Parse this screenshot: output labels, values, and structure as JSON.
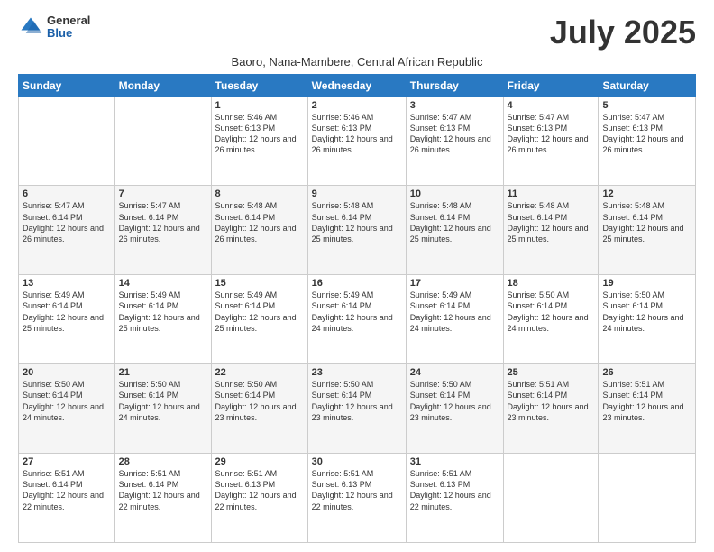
{
  "logo": {
    "general": "General",
    "blue": "Blue"
  },
  "title": {
    "month": "July 2025",
    "location": "Baoro, Nana-Mambere, Central African Republic"
  },
  "weekdays": [
    "Sunday",
    "Monday",
    "Tuesday",
    "Wednesday",
    "Thursday",
    "Friday",
    "Saturday"
  ],
  "weeks": [
    [
      {
        "day": "",
        "info": ""
      },
      {
        "day": "",
        "info": ""
      },
      {
        "day": "1",
        "info": "Sunrise: 5:46 AM\nSunset: 6:13 PM\nDaylight: 12 hours and 26 minutes."
      },
      {
        "day": "2",
        "info": "Sunrise: 5:46 AM\nSunset: 6:13 PM\nDaylight: 12 hours and 26 minutes."
      },
      {
        "day": "3",
        "info": "Sunrise: 5:47 AM\nSunset: 6:13 PM\nDaylight: 12 hours and 26 minutes."
      },
      {
        "day": "4",
        "info": "Sunrise: 5:47 AM\nSunset: 6:13 PM\nDaylight: 12 hours and 26 minutes."
      },
      {
        "day": "5",
        "info": "Sunrise: 5:47 AM\nSunset: 6:13 PM\nDaylight: 12 hours and 26 minutes."
      }
    ],
    [
      {
        "day": "6",
        "info": "Sunrise: 5:47 AM\nSunset: 6:14 PM\nDaylight: 12 hours and 26 minutes."
      },
      {
        "day": "7",
        "info": "Sunrise: 5:47 AM\nSunset: 6:14 PM\nDaylight: 12 hours and 26 minutes."
      },
      {
        "day": "8",
        "info": "Sunrise: 5:48 AM\nSunset: 6:14 PM\nDaylight: 12 hours and 26 minutes."
      },
      {
        "day": "9",
        "info": "Sunrise: 5:48 AM\nSunset: 6:14 PM\nDaylight: 12 hours and 25 minutes."
      },
      {
        "day": "10",
        "info": "Sunrise: 5:48 AM\nSunset: 6:14 PM\nDaylight: 12 hours and 25 minutes."
      },
      {
        "day": "11",
        "info": "Sunrise: 5:48 AM\nSunset: 6:14 PM\nDaylight: 12 hours and 25 minutes."
      },
      {
        "day": "12",
        "info": "Sunrise: 5:48 AM\nSunset: 6:14 PM\nDaylight: 12 hours and 25 minutes."
      }
    ],
    [
      {
        "day": "13",
        "info": "Sunrise: 5:49 AM\nSunset: 6:14 PM\nDaylight: 12 hours and 25 minutes."
      },
      {
        "day": "14",
        "info": "Sunrise: 5:49 AM\nSunset: 6:14 PM\nDaylight: 12 hours and 25 minutes."
      },
      {
        "day": "15",
        "info": "Sunrise: 5:49 AM\nSunset: 6:14 PM\nDaylight: 12 hours and 25 minutes."
      },
      {
        "day": "16",
        "info": "Sunrise: 5:49 AM\nSunset: 6:14 PM\nDaylight: 12 hours and 24 minutes."
      },
      {
        "day": "17",
        "info": "Sunrise: 5:49 AM\nSunset: 6:14 PM\nDaylight: 12 hours and 24 minutes."
      },
      {
        "day": "18",
        "info": "Sunrise: 5:50 AM\nSunset: 6:14 PM\nDaylight: 12 hours and 24 minutes."
      },
      {
        "day": "19",
        "info": "Sunrise: 5:50 AM\nSunset: 6:14 PM\nDaylight: 12 hours and 24 minutes."
      }
    ],
    [
      {
        "day": "20",
        "info": "Sunrise: 5:50 AM\nSunset: 6:14 PM\nDaylight: 12 hours and 24 minutes."
      },
      {
        "day": "21",
        "info": "Sunrise: 5:50 AM\nSunset: 6:14 PM\nDaylight: 12 hours and 24 minutes."
      },
      {
        "day": "22",
        "info": "Sunrise: 5:50 AM\nSunset: 6:14 PM\nDaylight: 12 hours and 23 minutes."
      },
      {
        "day": "23",
        "info": "Sunrise: 5:50 AM\nSunset: 6:14 PM\nDaylight: 12 hours and 23 minutes."
      },
      {
        "day": "24",
        "info": "Sunrise: 5:50 AM\nSunset: 6:14 PM\nDaylight: 12 hours and 23 minutes."
      },
      {
        "day": "25",
        "info": "Sunrise: 5:51 AM\nSunset: 6:14 PM\nDaylight: 12 hours and 23 minutes."
      },
      {
        "day": "26",
        "info": "Sunrise: 5:51 AM\nSunset: 6:14 PM\nDaylight: 12 hours and 23 minutes."
      }
    ],
    [
      {
        "day": "27",
        "info": "Sunrise: 5:51 AM\nSunset: 6:14 PM\nDaylight: 12 hours and 22 minutes."
      },
      {
        "day": "28",
        "info": "Sunrise: 5:51 AM\nSunset: 6:14 PM\nDaylight: 12 hours and 22 minutes."
      },
      {
        "day": "29",
        "info": "Sunrise: 5:51 AM\nSunset: 6:13 PM\nDaylight: 12 hours and 22 minutes."
      },
      {
        "day": "30",
        "info": "Sunrise: 5:51 AM\nSunset: 6:13 PM\nDaylight: 12 hours and 22 minutes."
      },
      {
        "day": "31",
        "info": "Sunrise: 5:51 AM\nSunset: 6:13 PM\nDaylight: 12 hours and 22 minutes."
      },
      {
        "day": "",
        "info": ""
      },
      {
        "day": "",
        "info": ""
      }
    ]
  ]
}
